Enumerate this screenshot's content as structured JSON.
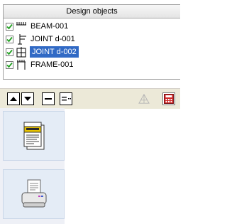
{
  "panel": {
    "title": "Design objects",
    "items": [
      {
        "label": "BEAM-001",
        "checked": true,
        "selected": false,
        "icon": "beam-icon"
      },
      {
        "label": "JOINT d-001",
        "checked": true,
        "selected": false,
        "icon": "joint-icon"
      },
      {
        "label": "JOINT d-002",
        "checked": true,
        "selected": true,
        "icon": "joint-icon"
      },
      {
        "label": "FRAME-001",
        "checked": true,
        "selected": false,
        "icon": "frame-icon"
      }
    ]
  },
  "toolbar": {
    "buttons": [
      "move-up-icon",
      "move-down-icon",
      "minus-icon",
      "dash-list-icon",
      "measure-icon",
      "calculator-icon"
    ]
  },
  "tiles": [
    "report-icon",
    "printer-icon"
  ],
  "colors": {
    "selection": "#316ac5",
    "check": "#22a022",
    "calculator": "#d02828"
  }
}
